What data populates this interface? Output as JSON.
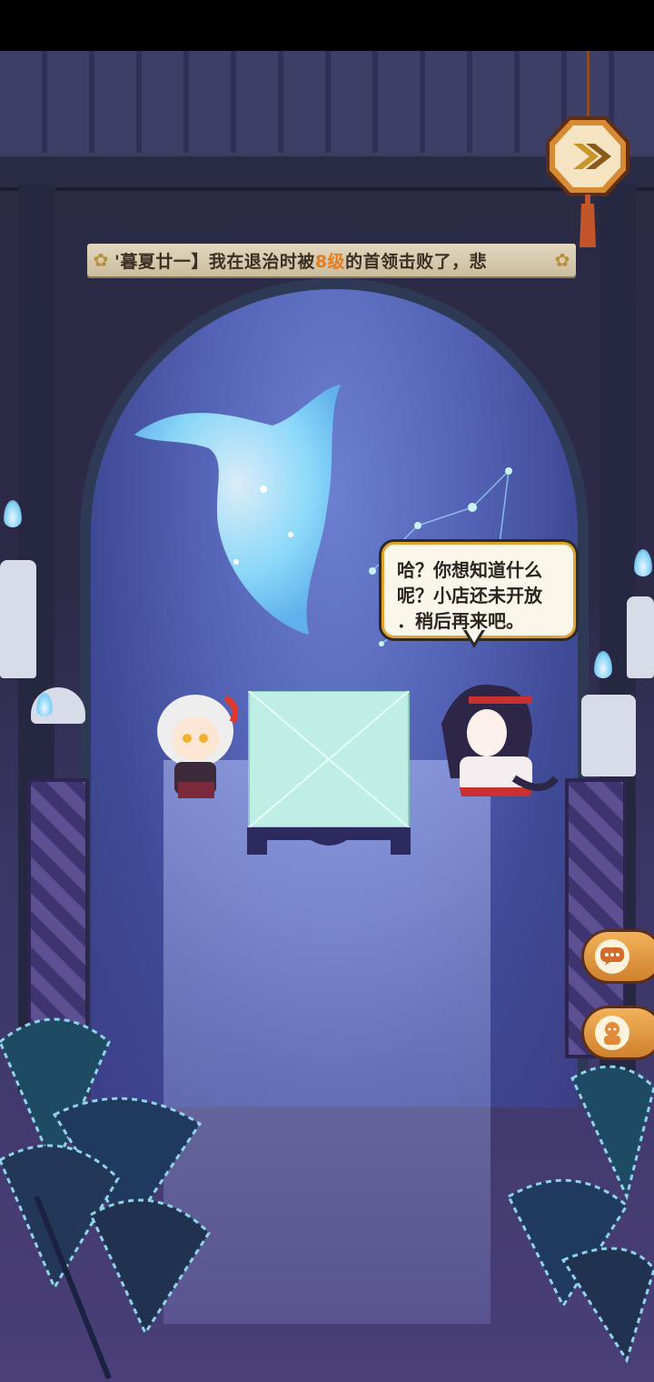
{
  "news_banner": {
    "prefix": "'暮夏廿一】我在退治时被",
    "highlight": "8级",
    "suffix": "的首领击败了，悲",
    "highlight_color": "#e67c1f"
  },
  "npc_speech": {
    "line1": "哈？你想知道什么",
    "line2": "呢？小店还未开放",
    "line3": "．稍后再来吧。"
  },
  "icons": {
    "next": "next-arrow-icon",
    "chat": "chat-bubble-icon",
    "shop": "shop-character-icon"
  },
  "colors": {
    "accent_orange": "#e67c1f",
    "bubble_border": "#e0a431",
    "glow_blue": "#8fe3ff"
  }
}
